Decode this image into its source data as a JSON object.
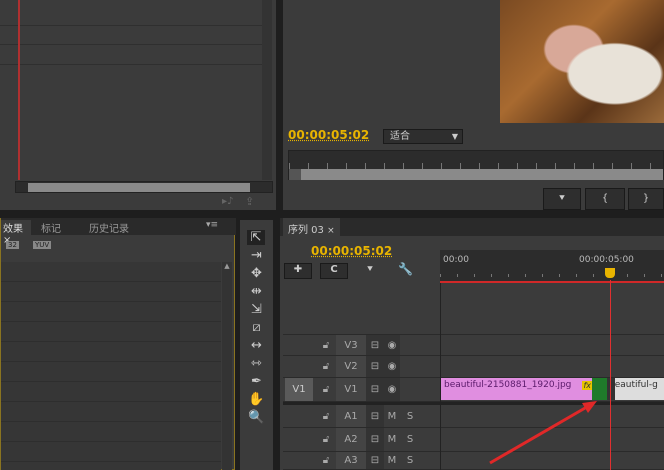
{
  "source_monitor": {
    "timecode": "00:00:05:02"
  },
  "program_monitor": {
    "timecode": "00:00:05:02",
    "zoom_select": "适合",
    "buttons": [
      "marker",
      "mark-in",
      "mark-out"
    ]
  },
  "project_panel": {
    "tabs": [
      {
        "label": "效果 ×"
      },
      {
        "label": "标记"
      },
      {
        "label": "历史记录"
      }
    ],
    "icons": [
      "32",
      "YUV"
    ]
  },
  "timeline": {
    "tab_label": "序列 03",
    "tab_close": "×",
    "timecode": "00:00:05:02",
    "ruler": [
      "00:00",
      "00:00:05:00"
    ],
    "tracks": {
      "v3": "V3",
      "v2": "V2",
      "v1": "V1",
      "v1_target": "V1",
      "a1": "A1",
      "a2": "A2",
      "a3": "A3",
      "mute": "M",
      "solo": "S"
    },
    "clips": [
      {
        "name": "beautiful-2150881_1920.jpg",
        "fx": "fx"
      },
      {
        "name": "beautiful-g"
      }
    ]
  },
  "colors": {
    "accent": "#e8b400",
    "clip": "#e08ee0",
    "playhead": "#e03030",
    "transition": "#1f7a2a"
  }
}
